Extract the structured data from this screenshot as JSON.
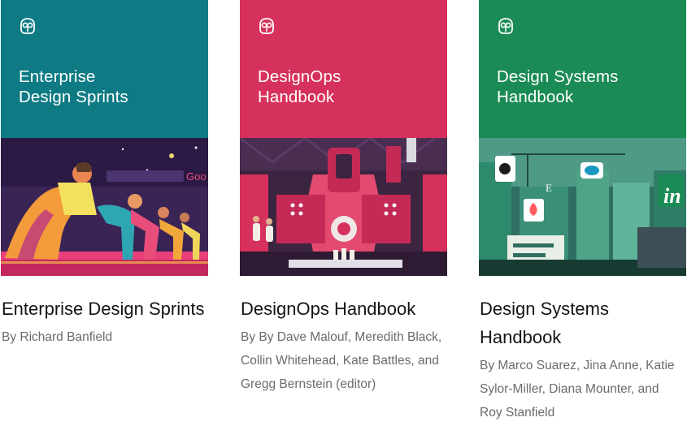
{
  "books": [
    {
      "cover_title": "Enterprise\nDesign Sprints",
      "title": "Enterprise Design Sprints",
      "authors": "By Richard Banfield",
      "cover_color": "#0e7b84",
      "art_scene": "runners-at-starting-line",
      "art_sign_text": "Goo"
    },
    {
      "cover_title": "DesignOps\nHandbook",
      "title": "DesignOps Handbook",
      "authors": "By By Dave Malouf, Meredith Black, Collin Whitehead, Kate Battles, and Gregg Bernstein (editor)",
      "cover_color": "#d6315d",
      "art_scene": "factory-machine-with-scientists"
    },
    {
      "cover_title": "Design Systems\nHandbook",
      "title": "Design Systems Handbook",
      "authors": "By Marco Suarez, Jina Anne, Katie Sylor-Miller, Diana Mounter, and Roy Stanfield",
      "cover_color": "#1b8b55",
      "art_scene": "city-with-brand-logos",
      "art_badge_text": "in",
      "art_letter_text": "E"
    }
  ],
  "logo_icon": "owl-logo-icon"
}
